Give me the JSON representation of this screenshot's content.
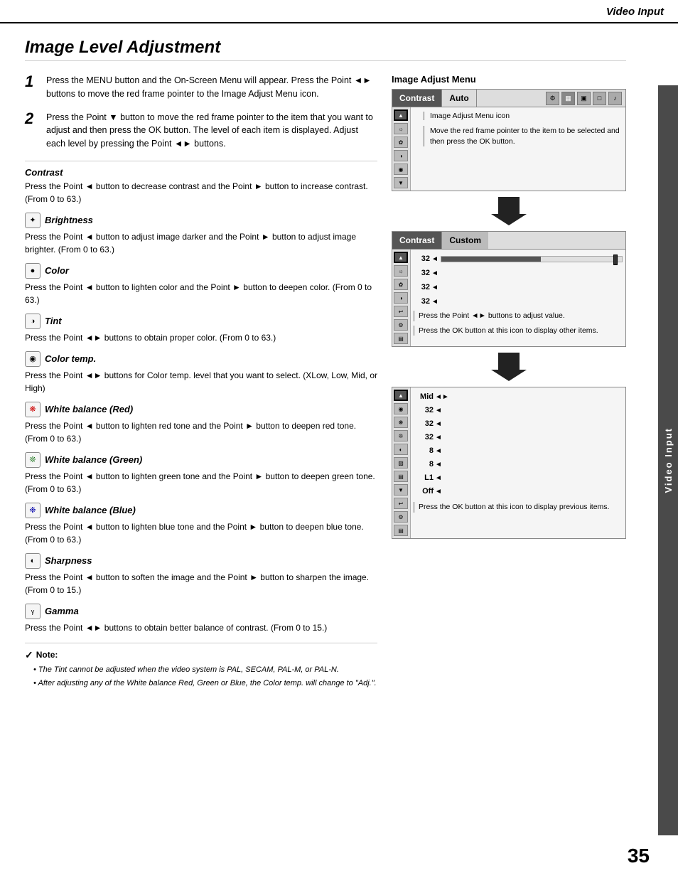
{
  "header": {
    "title": "Video Input"
  },
  "page": {
    "title": "Image Level Adjustment",
    "number": "35",
    "sidebar_label": "Video Input"
  },
  "steps": [
    {
      "num": "1",
      "text": "Press the MENU button and the On-Screen Menu will appear.  Press the Point ◄► buttons to move the red frame pointer to the Image Adjust Menu icon."
    },
    {
      "num": "2",
      "text": "Press the Point ▼ button to move the red frame pointer to the item that you want to adjust and then press the OK button.  The level of each item is displayed.  Adjust each level by pressing the Point ◄► buttons."
    }
  ],
  "sections": [
    {
      "id": "contrast",
      "title": "Contrast",
      "has_icon": false,
      "body": "Press the Point ◄ button to decrease contrast and the Point ► button to increase contrast.  (From 0 to 63.)"
    },
    {
      "id": "brightness",
      "title": "Brightness",
      "has_icon": true,
      "icon_sym": "✦",
      "body": "Press the Point ◄ button to adjust image darker and the Point ► button to adjust image brighter.  (From 0 to 63.)"
    },
    {
      "id": "color",
      "title": "Color",
      "has_icon": true,
      "icon_sym": "●",
      "body": "Press the Point ◄ button to lighten color and the Point ► button to deepen color.  (From 0 to 63.)"
    },
    {
      "id": "tint",
      "title": "Tint",
      "has_icon": true,
      "icon_sym": "◑",
      "body": "Press the Point ◄► buttons to obtain proper color.  (From 0 to 63.)"
    },
    {
      "id": "color-temp",
      "title": "Color temp.",
      "has_icon": true,
      "icon_sym": "◉",
      "body": "Press the Point ◄► buttons for Color temp. level that you want to select. (XLow, Low, Mid, or High)"
    },
    {
      "id": "wb-red",
      "title": "White balance (Red)",
      "has_icon": true,
      "icon_sym": "❋",
      "body": "Press the Point ◄ button to lighten red tone and the Point ► button to deepen red tone.  (From 0 to 63.)"
    },
    {
      "id": "wb-green",
      "title": "White balance (Green)",
      "has_icon": true,
      "icon_sym": "❊",
      "body": "Press the Point ◄ button to lighten green tone and the Point ► button to deepen green tone.  (From 0 to 63.)"
    },
    {
      "id": "wb-blue",
      "title": "White balance (Blue)",
      "has_icon": true,
      "icon_sym": "❉",
      "body": "Press the Point ◄ button to lighten blue tone and the Point ► button to deepen blue tone.  (From 0 to 63.)"
    },
    {
      "id": "sharpness",
      "title": "Sharpness",
      "has_icon": true,
      "icon_sym": "◐",
      "body": "Press the Point ◄ button to soften the image and the Point ► button to sharpen the image.  (From 0 to 15.)"
    },
    {
      "id": "gamma",
      "title": "Gamma",
      "has_icon": true,
      "icon_sym": "▨",
      "body": "Press the Point ◄► buttons to obtain better balance of contrast. (From 0 to 15.)"
    }
  ],
  "note": {
    "title": "Note:",
    "items": [
      "The Tint cannot be adjusted when the video system is PAL, SECAM, PAL-M, or PAL-N.",
      "After adjusting any of the White balance Red, Green or Blue, the Color temp. will change to \"Adj.\"."
    ]
  },
  "right_panel": {
    "diagram_title": "Image Adjust Menu",
    "menu_bar1": {
      "item1": "Contrast",
      "item2": "Auto"
    },
    "menu_bar2": {
      "item1": "Contrast",
      "item2": "Custom"
    },
    "icons": [
      "⚙",
      "▦",
      "▣",
      "□",
      "♪"
    ],
    "callout1": "Image Adjust Menu icon",
    "callout2": "Move the red frame pointer to the item to be selected and then press the OK button.",
    "rows1": [
      {
        "val": "32",
        "has_bar": true
      },
      {
        "val": "32",
        "has_bar": false
      },
      {
        "val": "32",
        "has_bar": false
      },
      {
        "val": "32",
        "has_bar": false
      }
    ],
    "callout3": "Press the Point ◄► buttons to adjust value.",
    "callout4": "Press the OK button at this icon to display other items.",
    "rows2": [
      {
        "label": "Mid",
        "val": "",
        "has_arrows": true
      },
      {
        "label": "32",
        "val": "",
        "has_arrows": true
      },
      {
        "label": "32",
        "val": "",
        "has_arrows": true
      },
      {
        "label": "32",
        "val": "",
        "has_arrows": true
      },
      {
        "label": "8",
        "val": "",
        "has_arrows": true
      },
      {
        "label": "8",
        "val": "",
        "has_arrows": true
      },
      {
        "label": "L1",
        "val": "",
        "has_arrows": true
      },
      {
        "label": "Off",
        "val": "",
        "has_arrows": true
      }
    ],
    "callout5": "Press the OK button at this icon to display previous items."
  }
}
